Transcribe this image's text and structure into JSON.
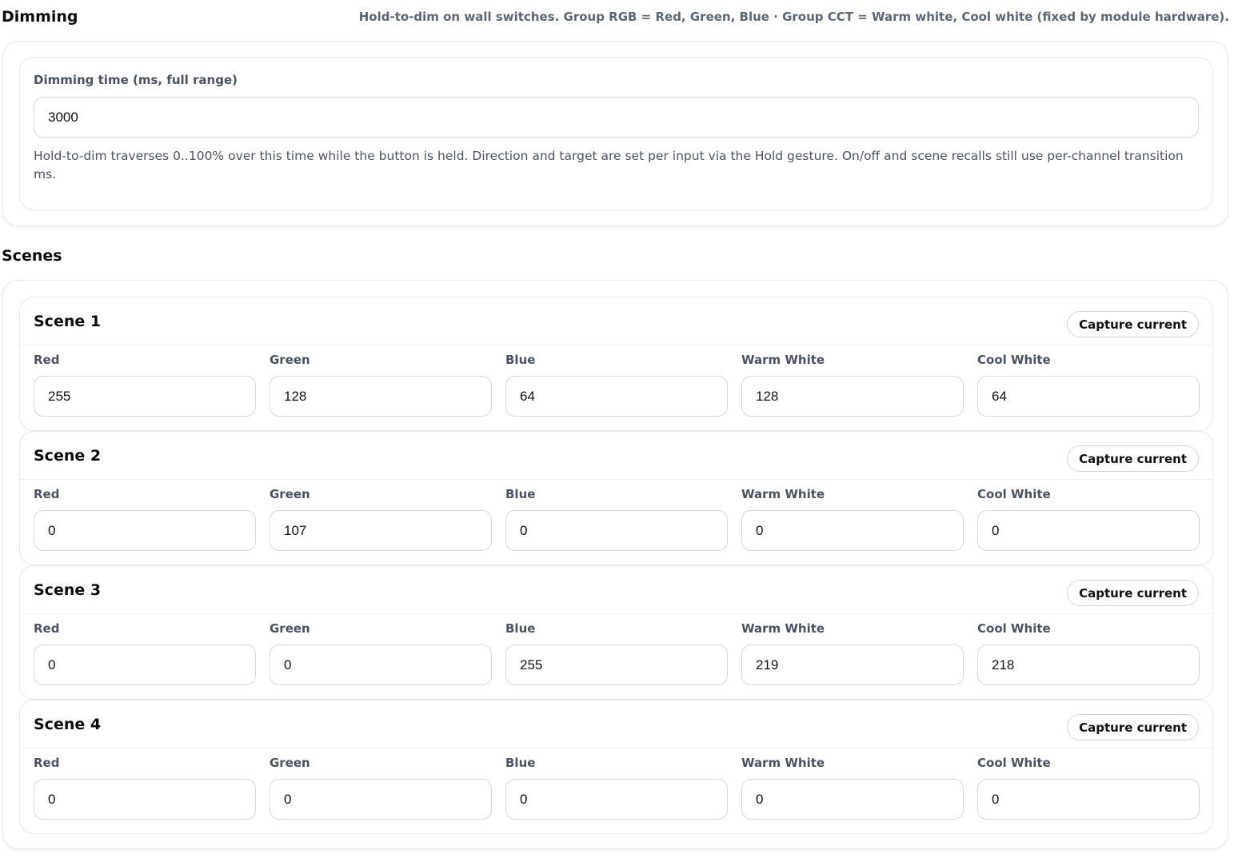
{
  "dimming": {
    "title": "Dimming",
    "note": "Hold-to-dim on wall switches. Group RGB = Red, Green, Blue · Group CCT = Warm white, Cool white (fixed by module hardware).",
    "time_label": "Dimming time (ms, full range)",
    "time_value": "3000",
    "help": "Hold-to-dim traverses 0..100% over this time while the button is held. Direction and target are set per input via the Hold gesture. On/off and scene recalls still use per-channel transition ms."
  },
  "scenes": {
    "title": "Scenes",
    "capture_label": "Capture current",
    "channel_labels": [
      "Red",
      "Green",
      "Blue",
      "Warm White",
      "Cool White"
    ],
    "items": [
      {
        "name": "Scene 1",
        "values": [
          "255",
          "128",
          "64",
          "128",
          "64"
        ]
      },
      {
        "name": "Scene 2",
        "values": [
          "0",
          "107",
          "0",
          "0",
          "0"
        ]
      },
      {
        "name": "Scene 3",
        "values": [
          "0",
          "0",
          "255",
          "219",
          "218"
        ]
      },
      {
        "name": "Scene 4",
        "values": [
          "0",
          "0",
          "0",
          "0",
          "0"
        ]
      }
    ]
  }
}
